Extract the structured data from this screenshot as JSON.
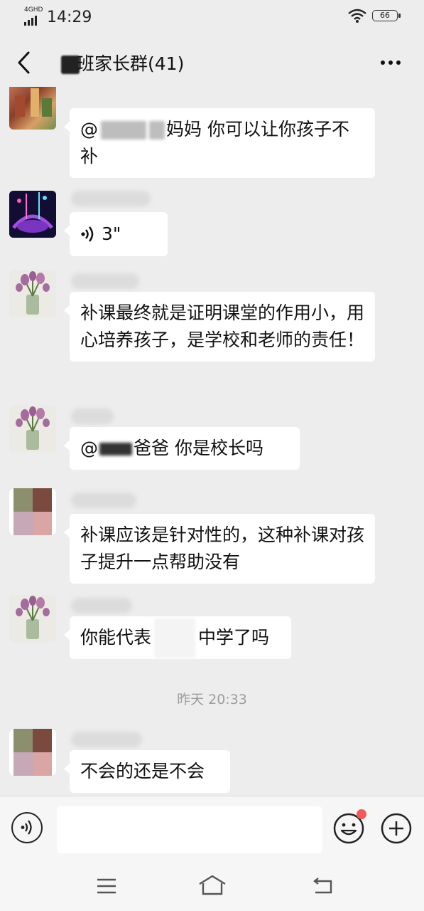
{
  "status": {
    "network": "4GHD",
    "time": "14:29",
    "battery": "66"
  },
  "header": {
    "title": "班家长群(41)"
  },
  "messages": [
    {
      "id": 1,
      "text_pre": "@",
      "text_post": "妈妈  你可以让你孩子不补"
    },
    {
      "id": 2,
      "voice_duration": "3\""
    },
    {
      "id": 3,
      "text": "补课最终就是证明课堂的作用小，用心培养孩子，是学校和老师的责任！"
    },
    {
      "id": 4,
      "text_pre": "@",
      "text_post": "爸爸  你是校长吗"
    },
    {
      "id": 5,
      "text": "补课应该是针对性的，这种补课对孩子提升一点帮助没有"
    },
    {
      "id": 6,
      "text_pre": "你能代表",
      "text_post": "中学了吗"
    },
    {
      "id": 7,
      "text": "不会的还是不会"
    }
  ],
  "timestamp": "昨天 20:33"
}
